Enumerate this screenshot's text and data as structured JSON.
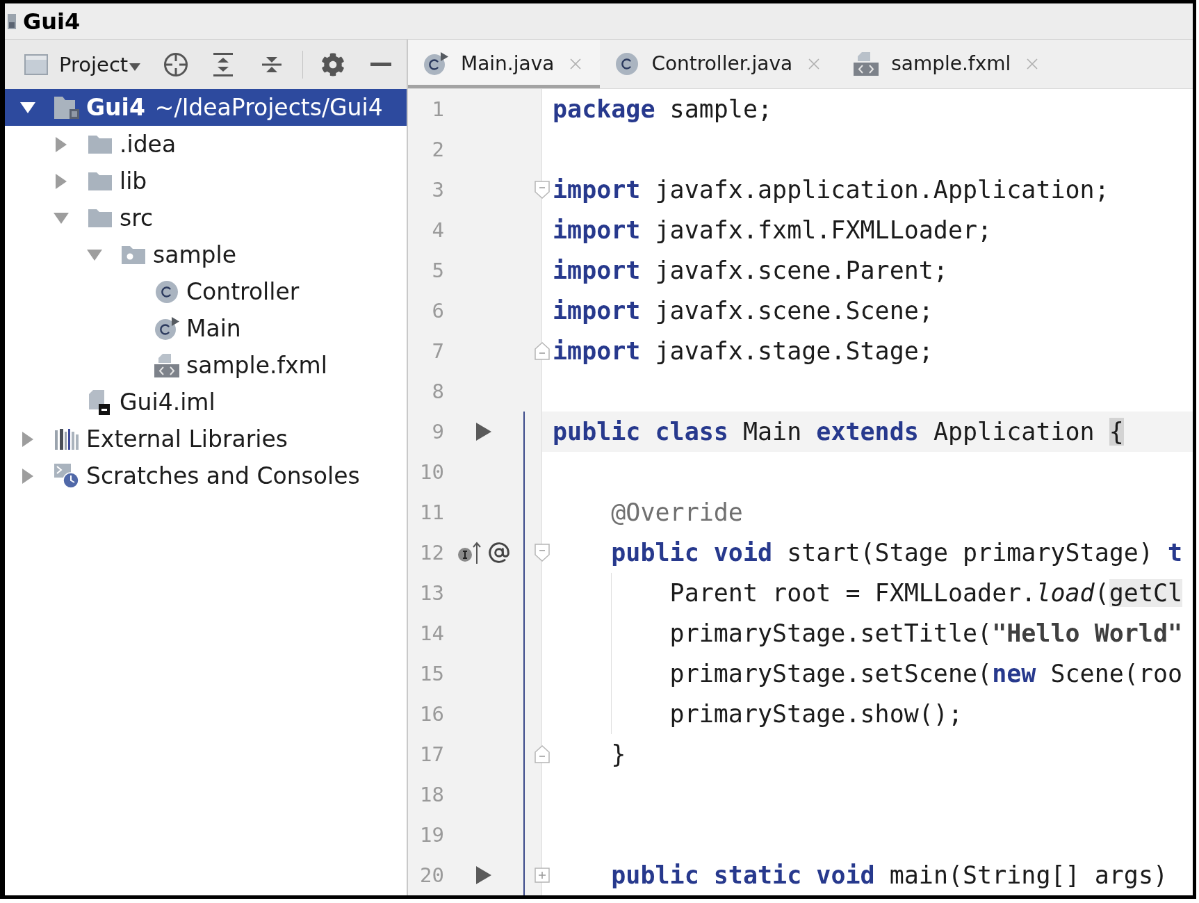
{
  "window": {
    "title": "Gui4"
  },
  "project_panel": {
    "view": "Project",
    "tree": [
      {
        "kind": "module",
        "label": "Gui4",
        "path": "~/IdeaProjects/Gui4",
        "expanded": true,
        "selected": true,
        "children": [
          {
            "kind": "folder",
            "label": ".idea",
            "expanded": false,
            "selected": false
          },
          {
            "kind": "folder",
            "label": "lib",
            "expanded": false,
            "selected": false
          },
          {
            "kind": "folder",
            "label": "src",
            "expanded": true,
            "selected": false,
            "children": [
              {
                "kind": "package",
                "label": "sample",
                "expanded": true,
                "selected": false,
                "children": [
                  {
                    "kind": "class",
                    "label": "Controller",
                    "selected": false
                  },
                  {
                    "kind": "main-class",
                    "label": "Main",
                    "selected": false
                  },
                  {
                    "kind": "fxml",
                    "label": "sample.fxml",
                    "selected": false
                  }
                ]
              }
            ]
          },
          {
            "kind": "module-file",
            "label": "Gui4.iml",
            "selected": false
          }
        ]
      },
      {
        "kind": "libraries",
        "label": "External Libraries",
        "expanded": false,
        "selected": false
      },
      {
        "kind": "scratches",
        "label": "Scratches and Consoles",
        "expanded": false,
        "selected": false
      }
    ]
  },
  "editor": {
    "tabs": [
      {
        "kind": "main-class",
        "label": "Main.java",
        "selected": true
      },
      {
        "kind": "class",
        "label": "Controller.java",
        "selected": false
      },
      {
        "kind": "fxml",
        "label": "sample.fxml",
        "selected": false
      }
    ],
    "lines": [
      {
        "number": "1",
        "current": false,
        "tokens": [
          {
            "kind": "keyword",
            "text": "package"
          },
          {
            "kind": "plain",
            "text": " sample;"
          }
        ]
      },
      {
        "number": "2",
        "current": false
      },
      {
        "number": "3",
        "current": false,
        "fold": {
          "kind": "start"
        },
        "tokens": [
          {
            "kind": "keyword",
            "text": "import"
          },
          {
            "kind": "plain",
            "text": " javafx.application.Application;"
          }
        ]
      },
      {
        "number": "4",
        "current": false,
        "tokens": [
          {
            "kind": "keyword",
            "text": "import"
          },
          {
            "kind": "plain",
            "text": " javafx.fxml.FXMLLoader;"
          }
        ]
      },
      {
        "number": "5",
        "current": false,
        "tokens": [
          {
            "kind": "keyword",
            "text": "import"
          },
          {
            "kind": "plain",
            "text": " javafx.scene.Parent;"
          }
        ]
      },
      {
        "number": "6",
        "current": false,
        "tokens": [
          {
            "kind": "keyword",
            "text": "import"
          },
          {
            "kind": "plain",
            "text": " javafx.scene.Scene;"
          }
        ]
      },
      {
        "number": "7",
        "current": false,
        "fold": {
          "kind": "end"
        },
        "tokens": [
          {
            "kind": "keyword",
            "text": "import"
          },
          {
            "kind": "plain",
            "text": " javafx.stage.Stage;"
          }
        ]
      },
      {
        "number": "8",
        "current": false
      },
      {
        "number": "9",
        "current": true,
        "gutter": [
          {
            "kind": "run"
          }
        ],
        "tokens": [
          {
            "kind": "keyword",
            "text": "public "
          },
          {
            "kind": "keyword",
            "text": "class"
          },
          {
            "kind": "plain",
            "text": " Main "
          },
          {
            "kind": "keyword",
            "text": "extends"
          },
          {
            "kind": "plain",
            "text": " Application "
          },
          {
            "kind": "brace",
            "text": "{"
          }
        ]
      },
      {
        "number": "10",
        "current": false
      },
      {
        "number": "11",
        "current": false,
        "tokens": [
          {
            "kind": "annotation",
            "text": "    @Override"
          }
        ]
      },
      {
        "number": "12",
        "current": false,
        "fold": {
          "kind": "start"
        },
        "gutter": [
          {
            "kind": "implements"
          },
          {
            "kind": "annotation"
          }
        ],
        "tokens": [
          {
            "kind": "keyword",
            "text": "    public "
          },
          {
            "kind": "keyword",
            "text": "void"
          },
          {
            "kind": "plain",
            "text": " start(Stage primaryStage) "
          },
          {
            "kind": "keyword",
            "text": "t"
          }
        ]
      },
      {
        "number": "13",
        "current": false,
        "tokens": [
          {
            "kind": "plain",
            "text": "        Parent root = FXMLLoader."
          },
          {
            "kind": "static-call",
            "text": "load"
          },
          {
            "kind": "plain",
            "text": "("
          },
          {
            "kind": "highlight",
            "text": "getCl"
          }
        ]
      },
      {
        "number": "14",
        "current": false,
        "tokens": [
          {
            "kind": "plain",
            "text": "        primaryStage.setTitle("
          },
          {
            "kind": "string",
            "text": "\"Hello World\""
          }
        ]
      },
      {
        "number": "15",
        "current": false,
        "tokens": [
          {
            "kind": "plain",
            "text": "        primaryStage.setScene("
          },
          {
            "kind": "keyword",
            "text": "new"
          },
          {
            "kind": "plain",
            "text": " Scene(roo"
          }
        ]
      },
      {
        "number": "16",
        "current": false,
        "tokens": [
          {
            "kind": "plain",
            "text": "        primaryStage.show();"
          }
        ]
      },
      {
        "number": "17",
        "current": false,
        "fold": {
          "kind": "end"
        },
        "tokens": [
          {
            "kind": "plain",
            "text": "    }"
          }
        ]
      },
      {
        "number": "18",
        "current": false
      },
      {
        "number": "19",
        "current": false
      },
      {
        "number": "20",
        "current": false,
        "fold": {
          "kind": "collapsed"
        },
        "gutter": [
          {
            "kind": "run"
          }
        ],
        "tokens": [
          {
            "kind": "keyword",
            "text": "    public "
          },
          {
            "kind": "keyword",
            "text": "static "
          },
          {
            "kind": "keyword",
            "text": "void"
          },
          {
            "kind": "plain",
            "text": " main(String[] args)"
          }
        ]
      }
    ]
  }
}
